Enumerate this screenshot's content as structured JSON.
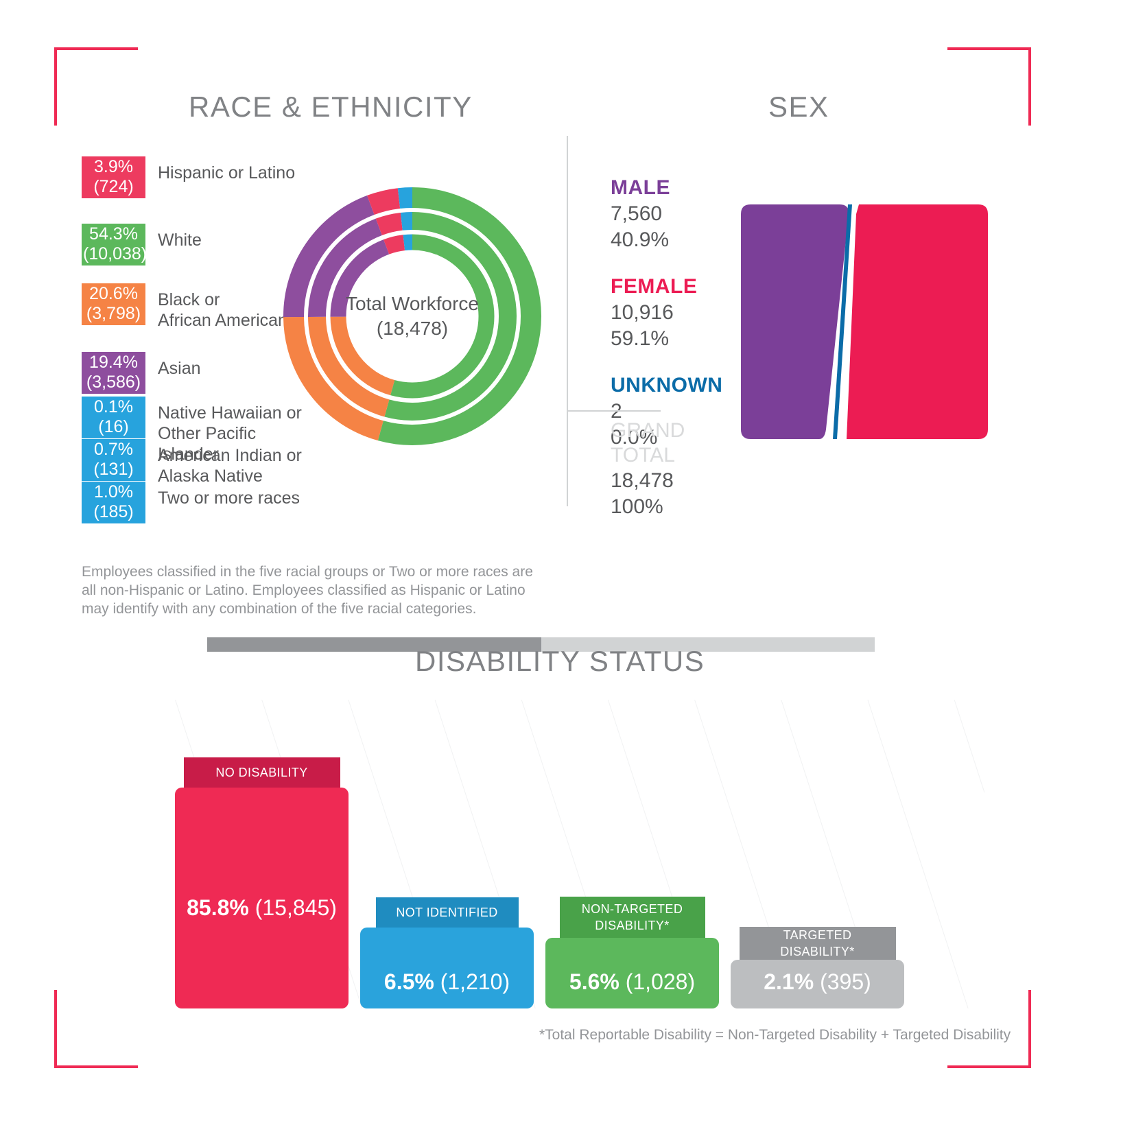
{
  "race": {
    "title": "RACE & ETHNICITY",
    "legend": [
      {
        "pct": "3.9%",
        "count": "(724)",
        "label": "Hispanic or Latino",
        "color": "#ed3b5f"
      },
      {
        "pct": "54.3%",
        "count": "(10,038)",
        "label": "White",
        "color": "#5cb85c"
      },
      {
        "pct": "20.6%",
        "count": "(3,798)",
        "label": "Black or\nAfrican American",
        "color": "#f58345"
      },
      {
        "pct": "19.4%",
        "count": "(3,586)",
        "label": "Asian",
        "color": "#8e4e9e"
      },
      {
        "pct": "0.1%",
        "count": "(16)",
        "label": "Native Hawaiian or\nOther Pacific Islander",
        "color": "#27a3dd"
      },
      {
        "pct": "0.7%",
        "count": "(131)",
        "label": "American Indian or\nAlaska Native",
        "color": "#27a3dd"
      },
      {
        "pct": "1.0%",
        "count": "(185)",
        "label": "Two or more races",
        "color": "#27a3dd"
      }
    ],
    "center_line1": "Total Workforce",
    "center_line2": "(18,478)",
    "note": "Employees classified in the five racial groups or Two or more races are all non-Hispanic or Latino. Employees classified as Hispanic or Latino may identify with any combination of the five racial categories."
  },
  "sex": {
    "title": "SEX",
    "groups": [
      {
        "name": "MALE",
        "count": "7,560",
        "pct": "40.9%",
        "color": "#7b3f98"
      },
      {
        "name": "FEMALE",
        "count": "10,916",
        "pct": "59.1%",
        "color": "#ec1c53"
      },
      {
        "name": "UNKNOWN",
        "count": "2",
        "pct": "0.0%",
        "color": "#0b6ca8"
      }
    ],
    "total": {
      "name_line1": "GRAND",
      "name_line2": "TOTAL",
      "count": "18,478",
      "pct": "100%"
    }
  },
  "disability": {
    "title": "DISABILITY STATUS",
    "bars": [
      {
        "label": "NO DISABILITY",
        "pct": "85.8%",
        "count": "(15,845)",
        "color": "#ef2a54",
        "tab_color": "#c81c48"
      },
      {
        "label": "NOT IDENTIFIED",
        "pct": "6.5%",
        "count": "(1,210)",
        "color": "#2aa3dc",
        "tab_color": "#1f8cc0"
      },
      {
        "label": "NON-TARGETED\nDISABILITY*",
        "pct": "5.6%",
        "count": "(1,028)",
        "color": "#5cb85c",
        "tab_color": "#49a249"
      },
      {
        "label": "TARGETED DISABILITY*",
        "pct": "2.1%",
        "count": "(395)",
        "color": "#bcbec0",
        "tab_color": "#939598"
      }
    ],
    "note": "*Total Reportable Disability = Non-Targeted Disability + Targeted Disability"
  },
  "chart_data": [
    {
      "type": "pie",
      "title": "RACE & ETHNICITY",
      "center_label": "Total Workforce (18,478)",
      "categories": [
        "White",
        "Black or African American",
        "Asian",
        "Hispanic or Latino",
        "Two or more races",
        "American Indian or Alaska Native",
        "Native Hawaiian or Other Pacific Islander"
      ],
      "values": [
        10038,
        3798,
        3586,
        724,
        185,
        131,
        16
      ],
      "percents": [
        54.3,
        20.6,
        19.4,
        3.9,
        1.0,
        0.7,
        0.1
      ],
      "colors": [
        "#5cb85c",
        "#f58345",
        "#8e4e9e",
        "#ed3b5f",
        "#27a3dd",
        "#27a3dd",
        "#27a3dd"
      ],
      "total": 18478,
      "rings": 3,
      "legend": "left"
    },
    {
      "type": "bar",
      "title": "SEX",
      "categories": [
        "MALE",
        "FEMALE",
        "UNKNOWN"
      ],
      "values": [
        7560,
        10916,
        2
      ],
      "percents": [
        40.9,
        59.1,
        0.0
      ],
      "colors": [
        "#7b3f98",
        "#ec1c53",
        "#0b6ca8"
      ],
      "total": 18478,
      "total_pct": "100%"
    },
    {
      "type": "bar",
      "title": "DISABILITY STATUS",
      "categories": [
        "NO DISABILITY",
        "NOT IDENTIFIED",
        "NON-TARGETED DISABILITY*",
        "TARGETED DISABILITY*"
      ],
      "values": [
        15845,
        1210,
        1028,
        395
      ],
      "percents": [
        85.8,
        6.5,
        5.6,
        2.1
      ],
      "colors": [
        "#ef2a54",
        "#2aa3dc",
        "#5cb85c",
        "#bcbec0"
      ],
      "ylabel": "",
      "xlabel": "",
      "grid": false
    }
  ]
}
